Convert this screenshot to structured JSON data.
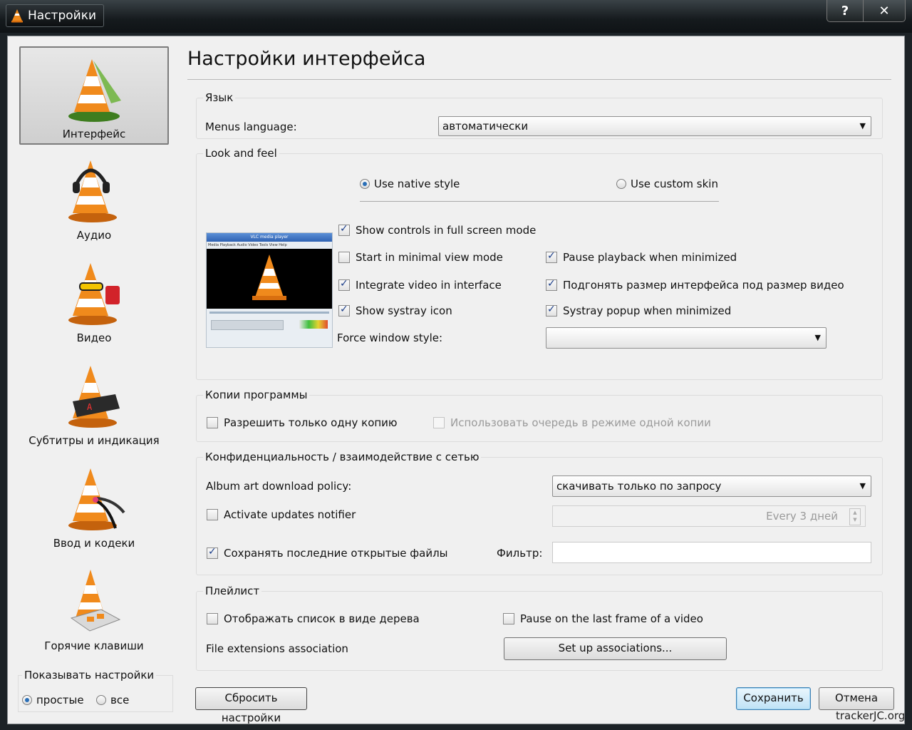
{
  "window": {
    "title": "Настройки",
    "help_label": "?",
    "close_label": "✕",
    "watermark": "trackerJC.org"
  },
  "sidebar": {
    "items": [
      {
        "label": "Интерфейс",
        "selected": true
      },
      {
        "label": "Аудио"
      },
      {
        "label": "Видео"
      },
      {
        "label": "Субтитры и индикация"
      },
      {
        "label": "Ввод и кодеки"
      },
      {
        "label": "Горячие клавиши"
      }
    ],
    "show_settings": {
      "title": "Показывать настройки",
      "simple": "простые",
      "all": "все",
      "selected": "simple"
    }
  },
  "main": {
    "title": "Настройки интерфейса",
    "language": {
      "group_title": "Язык",
      "menus_language_label": "Menus language:",
      "menus_language_value": "автоматически"
    },
    "look_and_feel": {
      "group_title": "Look and feel",
      "native_style": "Use native style",
      "custom_skin": "Use custom skin",
      "preview_title": "VLC media player",
      "preview_menu": "Media Playback Audio Video Tools View Help",
      "show_controls_fullscreen": "Show controls in full screen mode",
      "start_minimal": "Start in minimal view mode",
      "pause_minimized": "Pause playback when minimized",
      "integrate_video": "Integrate video in interface",
      "resize_interface": "Подгонять размер интерфейса под размер видео",
      "show_systray": "Show systray icon",
      "systray_popup": "Systray popup when minimized",
      "force_window_style_label": "Force window style:",
      "force_window_style_value": ""
    },
    "instances": {
      "group_title": "Копии программы",
      "single_instance": "Разрешить только одну копию",
      "enqueue_single": "Использовать очередь в режиме одной копии"
    },
    "privacy": {
      "group_title": "Конфиденциальность / взаимодействие с сетью",
      "album_art_label": "Album art download policy:",
      "album_art_value": "скачивать только по запросу",
      "updates_notifier": "Activate updates notifier",
      "updates_interval": "Every 3 дней",
      "save_recent": "Сохранять последние открытые файлы",
      "filter_label": "Фильтр:",
      "filter_value": ""
    },
    "playlist": {
      "group_title": "Плейлист",
      "tree_view": "Отображать список в виде дерева",
      "pause_last_frame": "Pause on the last frame of a video",
      "file_ext_label": "File extensions association",
      "setup_assoc_button": "Set up associations..."
    }
  },
  "footer": {
    "reset_button": "Сбросить настройки",
    "save_button": "Сохранить",
    "cancel_button": "Отмена"
  },
  "colors": {
    "cone_orange": "#f08a1c",
    "accent_blue": "#2a6fb7",
    "title_bar": "#151a1d"
  }
}
